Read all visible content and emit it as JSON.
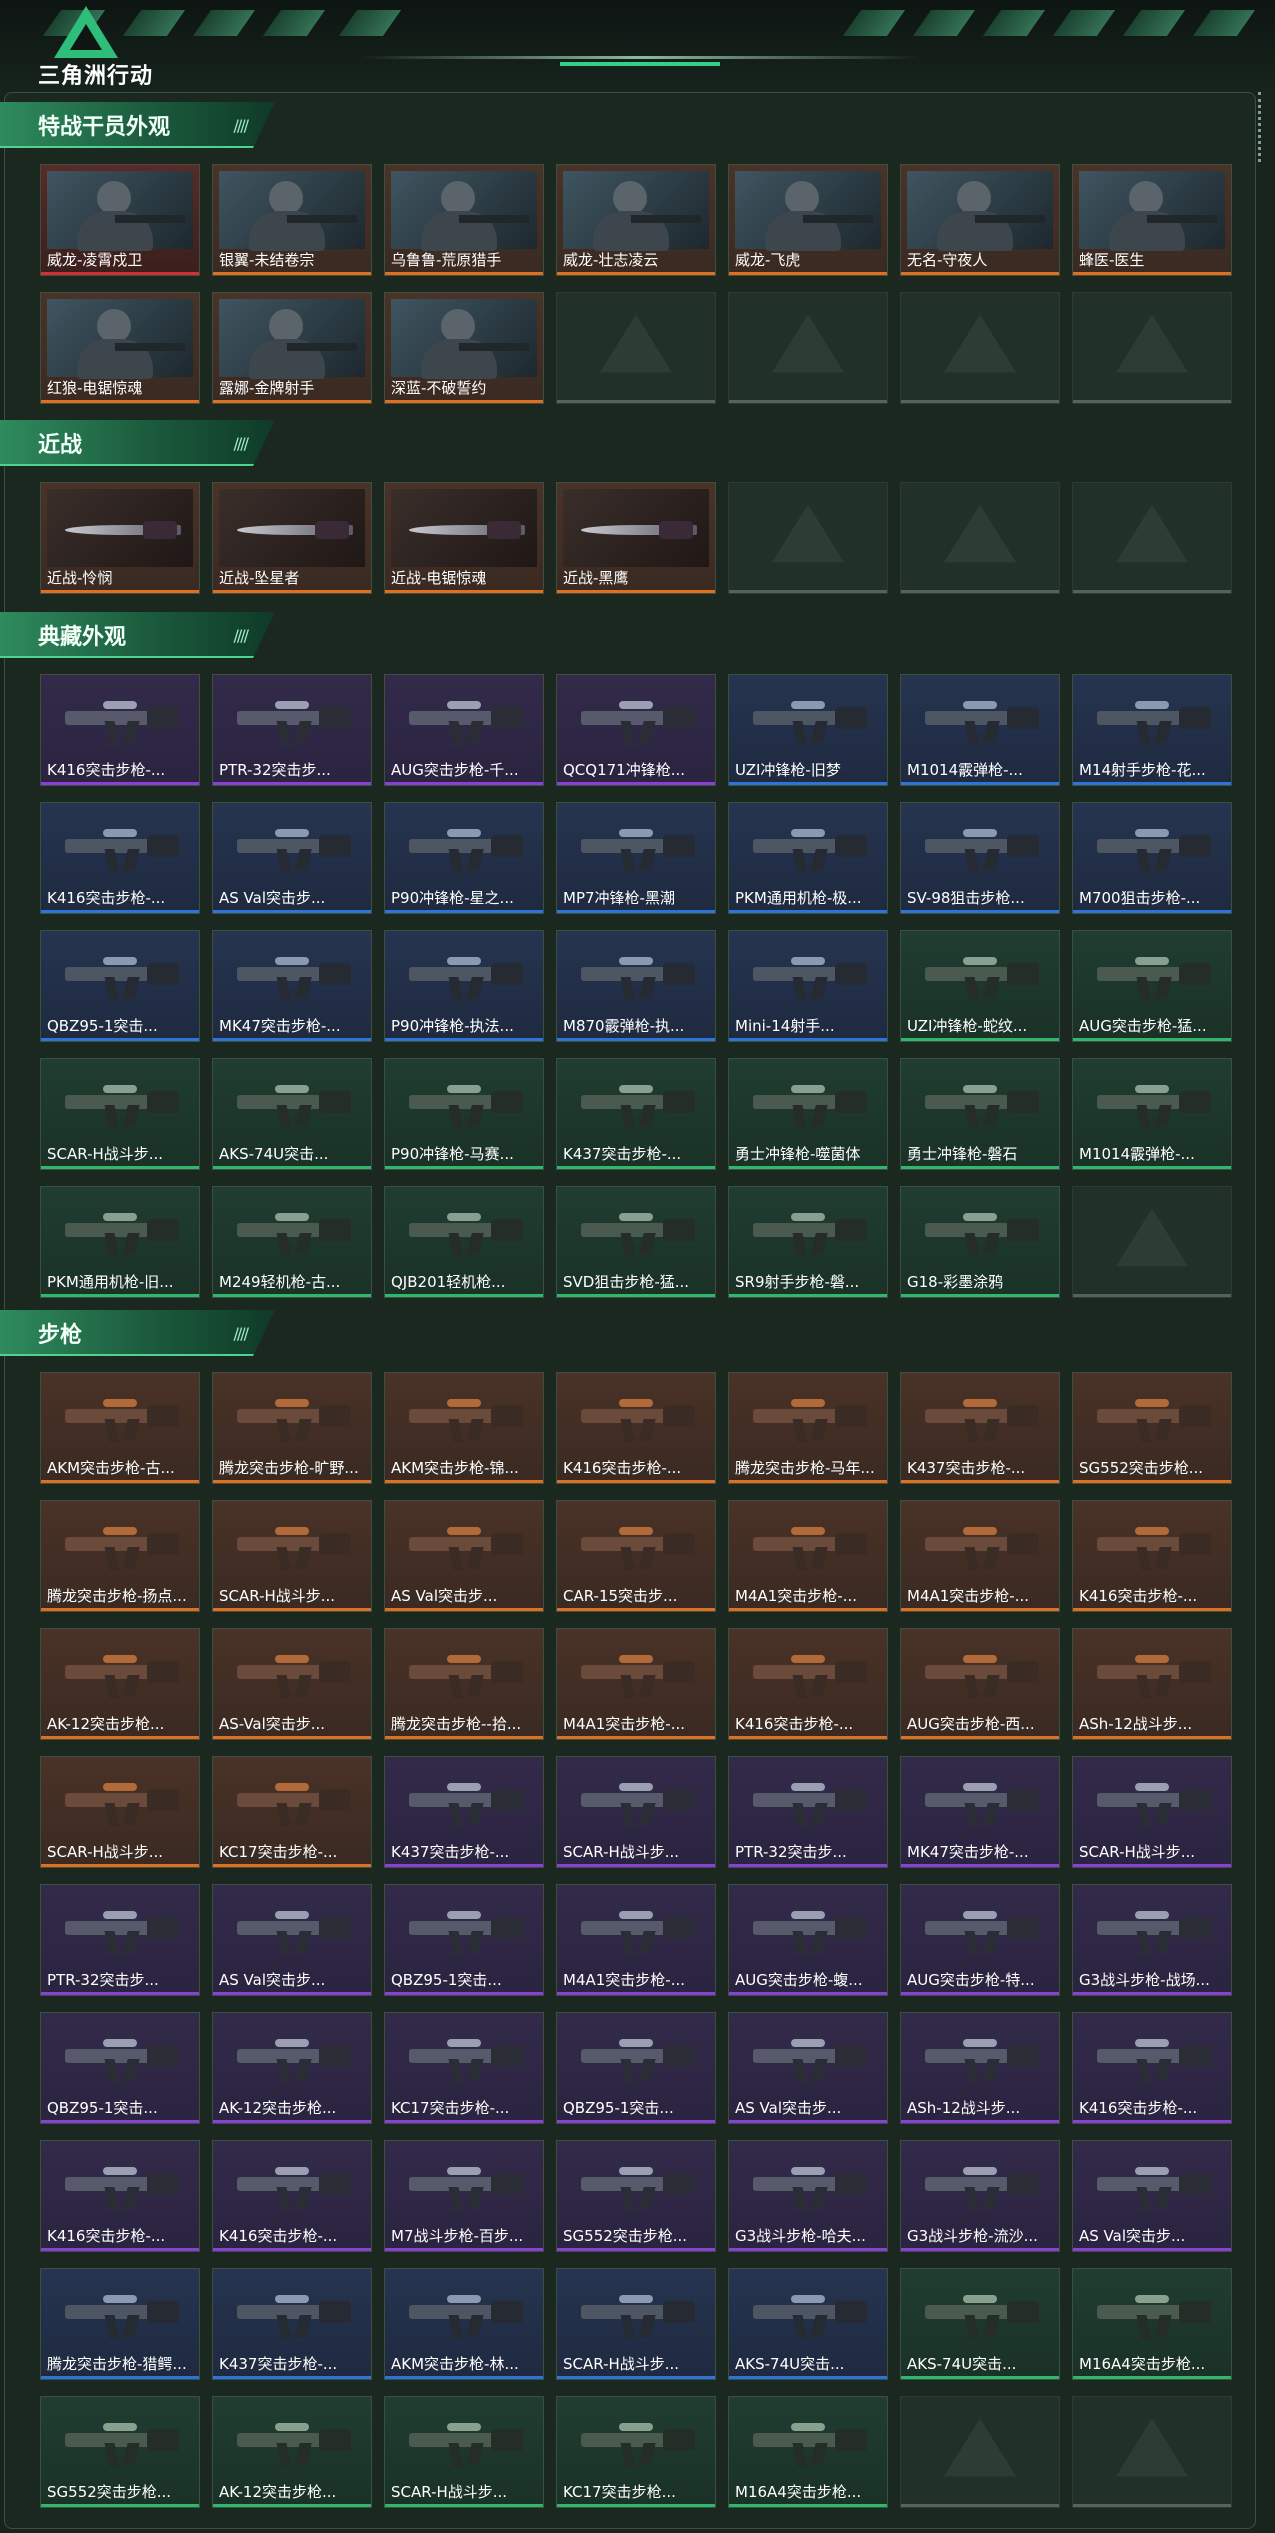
{
  "header": {
    "logo_text": "三角洲行动"
  },
  "colors": {
    "orange": "#e0701e",
    "gold": "#d98a1e",
    "red": "#d23030",
    "blue": "#2e74d8",
    "purple": "#8a3fd6",
    "green": "#2fb86b",
    "empty": "#56635d"
  },
  "sections": [
    {
      "title": "特战干员外观",
      "items": [
        {
          "label": "威龙-凌霄戍卫",
          "rarity": "red"
        },
        {
          "label": "银翼-未结卷宗",
          "rarity": "orange"
        },
        {
          "label": "乌鲁鲁-荒原猎手",
          "rarity": "orange"
        },
        {
          "label": "威龙-壮志凌云",
          "rarity": "orange"
        },
        {
          "label": "威龙-飞虎",
          "rarity": "orange"
        },
        {
          "label": "无名-守夜人",
          "rarity": "orange"
        },
        {
          "label": "蜂医-医生",
          "rarity": "orange"
        },
        {
          "label": "红狼-电锯惊魂",
          "rarity": "orange"
        },
        {
          "label": "露娜-金牌射手",
          "rarity": "orange"
        },
        {
          "label": "深蓝-不破誓约",
          "rarity": "orange"
        },
        {
          "label": "",
          "rarity": "empty"
        },
        {
          "label": "",
          "rarity": "empty"
        },
        {
          "label": "",
          "rarity": "empty"
        },
        {
          "label": "",
          "rarity": "empty"
        }
      ]
    },
    {
      "title": "近战",
      "items": [
        {
          "label": "近战-怜悯",
          "rarity": "orange"
        },
        {
          "label": "近战-坠星者",
          "rarity": "orange"
        },
        {
          "label": "近战-电锯惊魂",
          "rarity": "orange"
        },
        {
          "label": "近战-黑鹰",
          "rarity": "orange"
        },
        {
          "label": "",
          "rarity": "empty"
        },
        {
          "label": "",
          "rarity": "empty"
        },
        {
          "label": "",
          "rarity": "empty"
        }
      ]
    },
    {
      "title": "典藏外观",
      "items": [
        {
          "label": "K416突击步枪-...",
          "rarity": "purple"
        },
        {
          "label": "PTR-32突击步...",
          "rarity": "purple"
        },
        {
          "label": "AUG突击步枪-千...",
          "rarity": "purple"
        },
        {
          "label": "QCQ171冲锋枪...",
          "rarity": "purple"
        },
        {
          "label": "UZI冲锋枪-旧梦",
          "rarity": "blue"
        },
        {
          "label": "M1014霰弹枪-...",
          "rarity": "blue"
        },
        {
          "label": "M14射手步枪-花...",
          "rarity": "blue"
        },
        {
          "label": "K416突击步枪-...",
          "rarity": "blue"
        },
        {
          "label": "AS Val突击步...",
          "rarity": "blue"
        },
        {
          "label": "P90冲锋枪-星之...",
          "rarity": "blue"
        },
        {
          "label": "MP7冲锋枪-黑潮",
          "rarity": "blue"
        },
        {
          "label": "PKM通用机枪-极...",
          "rarity": "blue"
        },
        {
          "label": "SV-98狙击步枪...",
          "rarity": "blue"
        },
        {
          "label": "M700狙击步枪-...",
          "rarity": "blue"
        },
        {
          "label": "QBZ95-1突击...",
          "rarity": "blue"
        },
        {
          "label": "MK47突击步枪-...",
          "rarity": "blue"
        },
        {
          "label": "P90冲锋枪-执法...",
          "rarity": "blue"
        },
        {
          "label": "M870霰弹枪-执...",
          "rarity": "blue"
        },
        {
          "label": "Mini-14射手...",
          "rarity": "blue"
        },
        {
          "label": "UZI冲锋枪-蛇纹...",
          "rarity": "green"
        },
        {
          "label": "AUG突击步枪-猛...",
          "rarity": "green"
        },
        {
          "label": "SCAR-H战斗步...",
          "rarity": "green"
        },
        {
          "label": "AKS-74U突击...",
          "rarity": "green"
        },
        {
          "label": "P90冲锋枪-马赛...",
          "rarity": "green"
        },
        {
          "label": "K437突击步枪-...",
          "rarity": "green"
        },
        {
          "label": "勇士冲锋枪-噬菌体",
          "rarity": "green"
        },
        {
          "label": "勇士冲锋枪-磐石",
          "rarity": "green"
        },
        {
          "label": "M1014霰弹枪-...",
          "rarity": "green"
        },
        {
          "label": "PKM通用机枪-旧...",
          "rarity": "green"
        },
        {
          "label": "M249轻机枪-古...",
          "rarity": "green"
        },
        {
          "label": "QJB201轻机枪...",
          "rarity": "green"
        },
        {
          "label": "SVD狙击步枪-猛...",
          "rarity": "green"
        },
        {
          "label": "SR9射手步枪-磐...",
          "rarity": "green"
        },
        {
          "label": "G18-彩墨涂鸦",
          "rarity": "green"
        },
        {
          "label": "",
          "rarity": "empty"
        }
      ]
    },
    {
      "title": "步枪",
      "items": [
        {
          "label": "AKM突击步枪-古...",
          "rarity": "orange"
        },
        {
          "label": "腾龙突击步枪-旷野...",
          "rarity": "orange"
        },
        {
          "label": "AKM突击步枪-锦...",
          "rarity": "orange"
        },
        {
          "label": "K416突击步枪-...",
          "rarity": "orange"
        },
        {
          "label": "腾龙突击步枪-马年...",
          "rarity": "orange"
        },
        {
          "label": "K437突击步枪-...",
          "rarity": "orange"
        },
        {
          "label": "SG552突击步枪...",
          "rarity": "orange"
        },
        {
          "label": "腾龙突击步枪-扬点...",
          "rarity": "orange"
        },
        {
          "label": "SCAR-H战斗步...",
          "rarity": "orange"
        },
        {
          "label": "AS Val突击步...",
          "rarity": "orange"
        },
        {
          "label": "CAR-15突击步...",
          "rarity": "orange"
        },
        {
          "label": "M4A1突击步枪-...",
          "rarity": "orange"
        },
        {
          "label": "M4A1突击步枪-...",
          "rarity": "orange"
        },
        {
          "label": "K416突击步枪-...",
          "rarity": "orange"
        },
        {
          "label": "AK-12突击步枪...",
          "rarity": "orange"
        },
        {
          "label": "AS-Val突击步...",
          "rarity": "orange"
        },
        {
          "label": "腾龙突击步枪--拾...",
          "rarity": "orange"
        },
        {
          "label": "M4A1突击步枪-...",
          "rarity": "orange"
        },
        {
          "label": "K416突击步枪-...",
          "rarity": "orange"
        },
        {
          "label": "AUG突击步枪-西...",
          "rarity": "orange"
        },
        {
          "label": "ASh-12战斗步...",
          "rarity": "orange"
        },
        {
          "label": "SCAR-H战斗步...",
          "rarity": "orange"
        },
        {
          "label": "KC17突击步枪-...",
          "rarity": "orange"
        },
        {
          "label": "K437突击步枪-...",
          "rarity": "purple"
        },
        {
          "label": "SCAR-H战斗步...",
          "rarity": "purple"
        },
        {
          "label": "PTR-32突击步...",
          "rarity": "purple"
        },
        {
          "label": "MK47突击步枪-...",
          "rarity": "purple"
        },
        {
          "label": "SCAR-H战斗步...",
          "rarity": "purple"
        },
        {
          "label": "PTR-32突击步...",
          "rarity": "purple"
        },
        {
          "label": "AS Val突击步...",
          "rarity": "purple"
        },
        {
          "label": "QBZ95-1突击...",
          "rarity": "purple"
        },
        {
          "label": "M4A1突击步枪-...",
          "rarity": "purple"
        },
        {
          "label": "AUG突击步枪-蝮...",
          "rarity": "purple"
        },
        {
          "label": "AUG突击步枪-特...",
          "rarity": "purple"
        },
        {
          "label": "G3战斗步枪-战场...",
          "rarity": "purple"
        },
        {
          "label": "QBZ95-1突击...",
          "rarity": "purple"
        },
        {
          "label": "AK-12突击步枪...",
          "rarity": "purple"
        },
        {
          "label": "KC17突击步枪-...",
          "rarity": "purple"
        },
        {
          "label": "QBZ95-1突击...",
          "rarity": "purple"
        },
        {
          "label": "AS Val突击步...",
          "rarity": "purple"
        },
        {
          "label": "ASh-12战斗步...",
          "rarity": "purple"
        },
        {
          "label": "K416突击步枪-...",
          "rarity": "purple"
        },
        {
          "label": "K416突击步枪-...",
          "rarity": "purple"
        },
        {
          "label": "K416突击步枪-...",
          "rarity": "purple"
        },
        {
          "label": "M7战斗步枪-百步...",
          "rarity": "purple"
        },
        {
          "label": "SG552突击步枪...",
          "rarity": "purple"
        },
        {
          "label": "G3战斗步枪-哈夫...",
          "rarity": "purple"
        },
        {
          "label": "G3战斗步枪-流沙...",
          "rarity": "purple"
        },
        {
          "label": "AS Val突击步...",
          "rarity": "purple"
        },
        {
          "label": "腾龙突击步枪-猎鳄...",
          "rarity": "blue"
        },
        {
          "label": "K437突击步枪-...",
          "rarity": "blue"
        },
        {
          "label": "AKM突击步枪-林...",
          "rarity": "blue"
        },
        {
          "label": "SCAR-H战斗步...",
          "rarity": "blue"
        },
        {
          "label": "AKS-74U突击...",
          "rarity": "blue"
        },
        {
          "label": "AKS-74U突击...",
          "rarity": "green"
        },
        {
          "label": "M16A4突击步枪...",
          "rarity": "green"
        },
        {
          "label": "SG552突击步枪...",
          "rarity": "green"
        },
        {
          "label": "AK-12突击步枪...",
          "rarity": "green"
        },
        {
          "label": "SCAR-H战斗步...",
          "rarity": "green"
        },
        {
          "label": "KC17突击步枪...",
          "rarity": "green"
        },
        {
          "label": "M16A4突击步枪...",
          "rarity": "green"
        },
        {
          "label": "",
          "rarity": "empty"
        },
        {
          "label": "",
          "rarity": "empty"
        }
      ]
    }
  ]
}
